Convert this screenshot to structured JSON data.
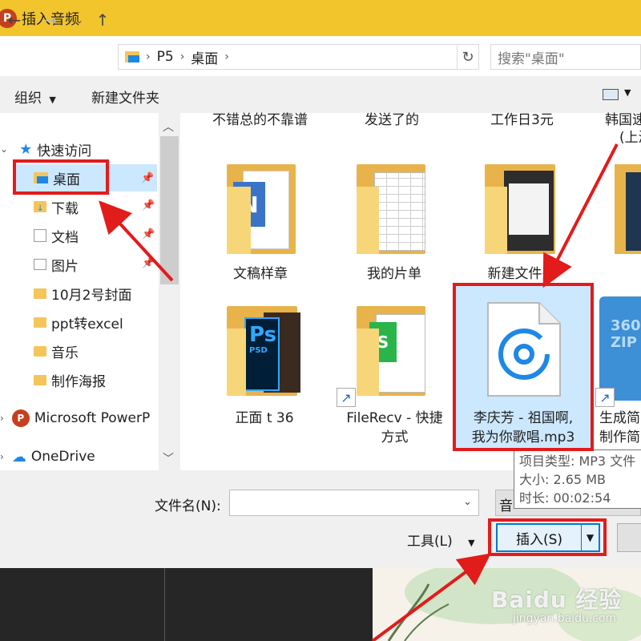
{
  "window": {
    "title": "插入音频",
    "app_badge": "P"
  },
  "address": {
    "crumbs": [
      "P5",
      "桌面"
    ],
    "search_placeholder": "搜索\"桌面\""
  },
  "toolbar": {
    "organize": "组织",
    "new_folder": "新建文件夹"
  },
  "nav": {
    "quick_access": "快速访问",
    "items": [
      "桌面",
      "下载",
      "文档",
      "图片",
      "10月2号封面",
      "ppt转excel",
      "音乐",
      "制作海报"
    ],
    "ms_powerpoint": "Microsoft PowerP",
    "onedrive": "OneDrive"
  },
  "files": {
    "top_partial": [
      "不错总的不靠谱",
      "发送了的",
      "工作日3元",
      "韩国速",
      "(上海"
    ],
    "row1": [
      "文稿样章",
      "我的片单",
      "新建文件夹"
    ],
    "row2": [
      {
        "line1": "正面 t  36",
        "line2": ""
      },
      {
        "line1": "FileRecv - 快捷",
        "line2": "方式"
      },
      {
        "line1": "李庆芳 - 祖国啊,",
        "line2": "我为你歌唱.mp3"
      },
      {
        "line1": "生成简",
        "line2": "制作简"
      }
    ]
  },
  "tooltip": {
    "type": "项目类型: MP3 文件",
    "size": "大小: 2.65 MB",
    "duration": "时长: 00:02:54"
  },
  "bottom": {
    "filename_label": "文件名(N):",
    "filename_value": "",
    "filetype_value": "音",
    "tools": "工具(L)",
    "insert": "插入(S)"
  },
  "watermark": {
    "brand": "Baidu 经验",
    "url": "jingyan.baidu.com"
  },
  "colors": {
    "title_bar": "#f2c52d",
    "accent": "#0078d7",
    "annotation": "#e21b1b",
    "selection": "#cce8ff"
  }
}
